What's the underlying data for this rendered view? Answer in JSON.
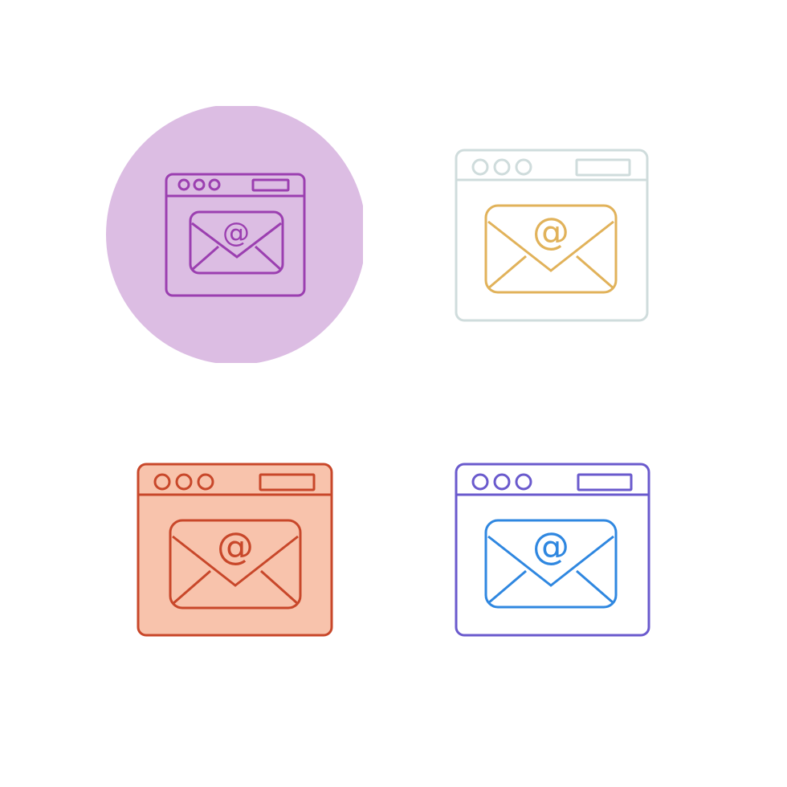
{
  "icons": [
    {
      "name": "email-browser-icon-circle",
      "variant": "line-on-circle",
      "symbol": "@",
      "colors": {
        "background": "#dcbde3",
        "frame": "#9b3fb0",
        "envelope": "#9b3fb0",
        "window_fill": "none",
        "envelope_fill": "none"
      }
    },
    {
      "name": "email-browser-icon-two-tone",
      "variant": "two-tone-line",
      "symbol": "@",
      "colors": {
        "background": "none",
        "frame": "#cfdcdc",
        "envelope": "#e1b25a",
        "window_fill": "none",
        "envelope_fill": "none"
      }
    },
    {
      "name": "email-browser-icon-filled",
      "variant": "filled",
      "symbol": "@",
      "colors": {
        "background": "none",
        "frame": "#c8472a",
        "envelope": "#c8472a",
        "window_fill": "#f8c3ac",
        "envelope_fill": "#f8c3ac"
      }
    },
    {
      "name": "email-browser-icon-line",
      "variant": "two-tone-line",
      "symbol": "@",
      "colors": {
        "background": "none",
        "frame": "#6a5acd",
        "envelope": "#2f87e0",
        "window_fill": "none",
        "envelope_fill": "none"
      }
    }
  ]
}
